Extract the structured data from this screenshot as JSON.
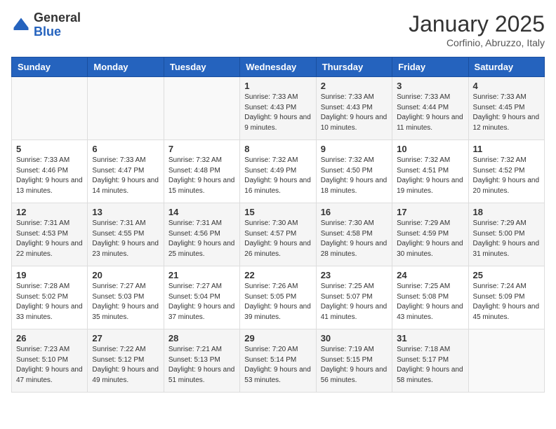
{
  "header": {
    "logo_general": "General",
    "logo_blue": "Blue",
    "month_title": "January 2025",
    "subtitle": "Corfinio, Abruzzo, Italy"
  },
  "weekdays": [
    "Sunday",
    "Monday",
    "Tuesday",
    "Wednesday",
    "Thursday",
    "Friday",
    "Saturday"
  ],
  "weeks": [
    [
      {
        "day": "",
        "sunrise": "",
        "sunset": "",
        "daylight": ""
      },
      {
        "day": "",
        "sunrise": "",
        "sunset": "",
        "daylight": ""
      },
      {
        "day": "",
        "sunrise": "",
        "sunset": "",
        "daylight": ""
      },
      {
        "day": "1",
        "sunrise": "Sunrise: 7:33 AM",
        "sunset": "Sunset: 4:43 PM",
        "daylight": "Daylight: 9 hours and 9 minutes."
      },
      {
        "day": "2",
        "sunrise": "Sunrise: 7:33 AM",
        "sunset": "Sunset: 4:43 PM",
        "daylight": "Daylight: 9 hours and 10 minutes."
      },
      {
        "day": "3",
        "sunrise": "Sunrise: 7:33 AM",
        "sunset": "Sunset: 4:44 PM",
        "daylight": "Daylight: 9 hours and 11 minutes."
      },
      {
        "day": "4",
        "sunrise": "Sunrise: 7:33 AM",
        "sunset": "Sunset: 4:45 PM",
        "daylight": "Daylight: 9 hours and 12 minutes."
      }
    ],
    [
      {
        "day": "5",
        "sunrise": "Sunrise: 7:33 AM",
        "sunset": "Sunset: 4:46 PM",
        "daylight": "Daylight: 9 hours and 13 minutes."
      },
      {
        "day": "6",
        "sunrise": "Sunrise: 7:33 AM",
        "sunset": "Sunset: 4:47 PM",
        "daylight": "Daylight: 9 hours and 14 minutes."
      },
      {
        "day": "7",
        "sunrise": "Sunrise: 7:32 AM",
        "sunset": "Sunset: 4:48 PM",
        "daylight": "Daylight: 9 hours and 15 minutes."
      },
      {
        "day": "8",
        "sunrise": "Sunrise: 7:32 AM",
        "sunset": "Sunset: 4:49 PM",
        "daylight": "Daylight: 9 hours and 16 minutes."
      },
      {
        "day": "9",
        "sunrise": "Sunrise: 7:32 AM",
        "sunset": "Sunset: 4:50 PM",
        "daylight": "Daylight: 9 hours and 18 minutes."
      },
      {
        "day": "10",
        "sunrise": "Sunrise: 7:32 AM",
        "sunset": "Sunset: 4:51 PM",
        "daylight": "Daylight: 9 hours and 19 minutes."
      },
      {
        "day": "11",
        "sunrise": "Sunrise: 7:32 AM",
        "sunset": "Sunset: 4:52 PM",
        "daylight": "Daylight: 9 hours and 20 minutes."
      }
    ],
    [
      {
        "day": "12",
        "sunrise": "Sunrise: 7:31 AM",
        "sunset": "Sunset: 4:53 PM",
        "daylight": "Daylight: 9 hours and 22 minutes."
      },
      {
        "day": "13",
        "sunrise": "Sunrise: 7:31 AM",
        "sunset": "Sunset: 4:55 PM",
        "daylight": "Daylight: 9 hours and 23 minutes."
      },
      {
        "day": "14",
        "sunrise": "Sunrise: 7:31 AM",
        "sunset": "Sunset: 4:56 PM",
        "daylight": "Daylight: 9 hours and 25 minutes."
      },
      {
        "day": "15",
        "sunrise": "Sunrise: 7:30 AM",
        "sunset": "Sunset: 4:57 PM",
        "daylight": "Daylight: 9 hours and 26 minutes."
      },
      {
        "day": "16",
        "sunrise": "Sunrise: 7:30 AM",
        "sunset": "Sunset: 4:58 PM",
        "daylight": "Daylight: 9 hours and 28 minutes."
      },
      {
        "day": "17",
        "sunrise": "Sunrise: 7:29 AM",
        "sunset": "Sunset: 4:59 PM",
        "daylight": "Daylight: 9 hours and 30 minutes."
      },
      {
        "day": "18",
        "sunrise": "Sunrise: 7:29 AM",
        "sunset": "Sunset: 5:00 PM",
        "daylight": "Daylight: 9 hours and 31 minutes."
      }
    ],
    [
      {
        "day": "19",
        "sunrise": "Sunrise: 7:28 AM",
        "sunset": "Sunset: 5:02 PM",
        "daylight": "Daylight: 9 hours and 33 minutes."
      },
      {
        "day": "20",
        "sunrise": "Sunrise: 7:27 AM",
        "sunset": "Sunset: 5:03 PM",
        "daylight": "Daylight: 9 hours and 35 minutes."
      },
      {
        "day": "21",
        "sunrise": "Sunrise: 7:27 AM",
        "sunset": "Sunset: 5:04 PM",
        "daylight": "Daylight: 9 hours and 37 minutes."
      },
      {
        "day": "22",
        "sunrise": "Sunrise: 7:26 AM",
        "sunset": "Sunset: 5:05 PM",
        "daylight": "Daylight: 9 hours and 39 minutes."
      },
      {
        "day": "23",
        "sunrise": "Sunrise: 7:25 AM",
        "sunset": "Sunset: 5:07 PM",
        "daylight": "Daylight: 9 hours and 41 minutes."
      },
      {
        "day": "24",
        "sunrise": "Sunrise: 7:25 AM",
        "sunset": "Sunset: 5:08 PM",
        "daylight": "Daylight: 9 hours and 43 minutes."
      },
      {
        "day": "25",
        "sunrise": "Sunrise: 7:24 AM",
        "sunset": "Sunset: 5:09 PM",
        "daylight": "Daylight: 9 hours and 45 minutes."
      }
    ],
    [
      {
        "day": "26",
        "sunrise": "Sunrise: 7:23 AM",
        "sunset": "Sunset: 5:10 PM",
        "daylight": "Daylight: 9 hours and 47 minutes."
      },
      {
        "day": "27",
        "sunrise": "Sunrise: 7:22 AM",
        "sunset": "Sunset: 5:12 PM",
        "daylight": "Daylight: 9 hours and 49 minutes."
      },
      {
        "day": "28",
        "sunrise": "Sunrise: 7:21 AM",
        "sunset": "Sunset: 5:13 PM",
        "daylight": "Daylight: 9 hours and 51 minutes."
      },
      {
        "day": "29",
        "sunrise": "Sunrise: 7:20 AM",
        "sunset": "Sunset: 5:14 PM",
        "daylight": "Daylight: 9 hours and 53 minutes."
      },
      {
        "day": "30",
        "sunrise": "Sunrise: 7:19 AM",
        "sunset": "Sunset: 5:15 PM",
        "daylight": "Daylight: 9 hours and 56 minutes."
      },
      {
        "day": "31",
        "sunrise": "Sunrise: 7:18 AM",
        "sunset": "Sunset: 5:17 PM",
        "daylight": "Daylight: 9 hours and 58 minutes."
      },
      {
        "day": "",
        "sunrise": "",
        "sunset": "",
        "daylight": ""
      }
    ]
  ]
}
